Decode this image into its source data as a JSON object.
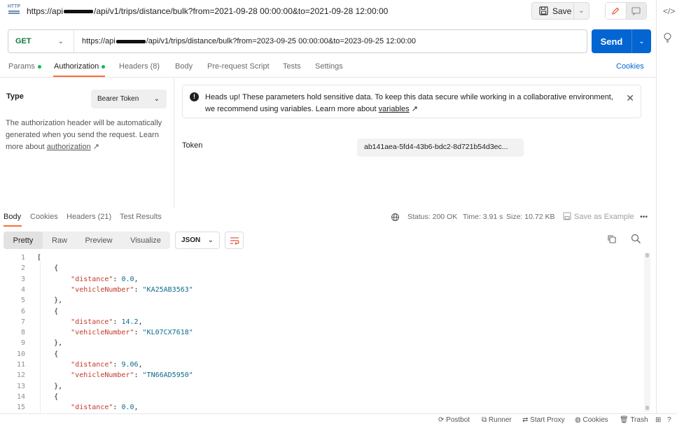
{
  "title_bar": {
    "icon_text": "HTTP",
    "url_prefix": "https://api",
    "url_suffix": "/api/v1/trips/distance/bulk?from=2021-09-28 00:00:00&to=2021-09-28 12:00:00",
    "save_label": "Save"
  },
  "request": {
    "method": "GET",
    "url_prefix": "https://api",
    "url_suffix": "/api/v1/trips/distance/bulk?from=2023-09-25 00:00:00&to=2023-09-25 12:00:00",
    "send_label": "Send"
  },
  "req_tabs": {
    "params": "Params",
    "authorization": "Authorization",
    "headers": "Headers (8)",
    "body": "Body",
    "prerequest": "Pre-request Script",
    "tests": "Tests",
    "settings": "Settings",
    "cookies": "Cookies"
  },
  "auth": {
    "type_label": "Type",
    "type_value": "Bearer Token",
    "desc_text": "The authorization header will be automatically generated when you send the request. Learn more about ",
    "desc_link": "authorization",
    "desc_arrow": " ↗",
    "alert_text": "Heads up! These parameters hold sensitive data. To keep this data secure while working in a collaborative environment, we recommend using variables. Learn more about ",
    "alert_link": "variables",
    "alert_arrow": " ↗",
    "token_label": "Token",
    "token_value": "ab141aea-5fd4-43b6-bdc2-8d721b54d3ec..."
  },
  "response": {
    "tabs": {
      "body": "Body",
      "cookies": "Cookies",
      "headers": "Headers (21)",
      "test_results": "Test Results"
    },
    "status": "Status: 200 OK",
    "time": "Time: 3.91 s",
    "size": "Size: 10.72 KB",
    "save_example": "Save as Example",
    "more": "•••",
    "views": {
      "pretty": "Pretty",
      "raw": "Raw",
      "preview": "Preview",
      "visualize": "Visualize"
    },
    "format": "JSON"
  },
  "code_lines": [
    {
      "n": "1",
      "t": "["
    },
    {
      "n": "2",
      "t": "    {"
    },
    {
      "n": "3",
      "key": "\"distance\"",
      "val": "0.0",
      "vtype": "n",
      "comma": ","
    },
    {
      "n": "4",
      "key": "\"vehicleNumber\"",
      "val": "\"KA25AB3563\"",
      "vtype": "s",
      "comma": ""
    },
    {
      "n": "5",
      "t": "    },"
    },
    {
      "n": "6",
      "t": "    {"
    },
    {
      "n": "7",
      "key": "\"distance\"",
      "val": "14.2",
      "vtype": "n",
      "comma": ","
    },
    {
      "n": "8",
      "key": "\"vehicleNumber\"",
      "val": "\"KL07CX7618\"",
      "vtype": "s",
      "comma": ""
    },
    {
      "n": "9",
      "t": "    },"
    },
    {
      "n": "10",
      "t": "    {"
    },
    {
      "n": "11",
      "key": "\"distance\"",
      "val": "9.06",
      "vtype": "n",
      "comma": ","
    },
    {
      "n": "12",
      "key": "\"vehicleNumber\"",
      "val": "\"TN66AD5950\"",
      "vtype": "s",
      "comma": ""
    },
    {
      "n": "13",
      "t": "    },"
    },
    {
      "n": "14",
      "t": "    {"
    },
    {
      "n": "15",
      "key": "\"distance\"",
      "val": "0.0",
      "vtype": "n",
      "comma": ","
    }
  ],
  "footer": {
    "postbot": "Postbot",
    "runner": "Runner",
    "start_proxy": "Start Proxy",
    "cookies": "Cookies",
    "trash": "Trash"
  },
  "colors": {
    "send": "#0265d2",
    "accent": "#ff6c37",
    "method": "#0f7b3c",
    "status_dot": "#0cbb52"
  }
}
